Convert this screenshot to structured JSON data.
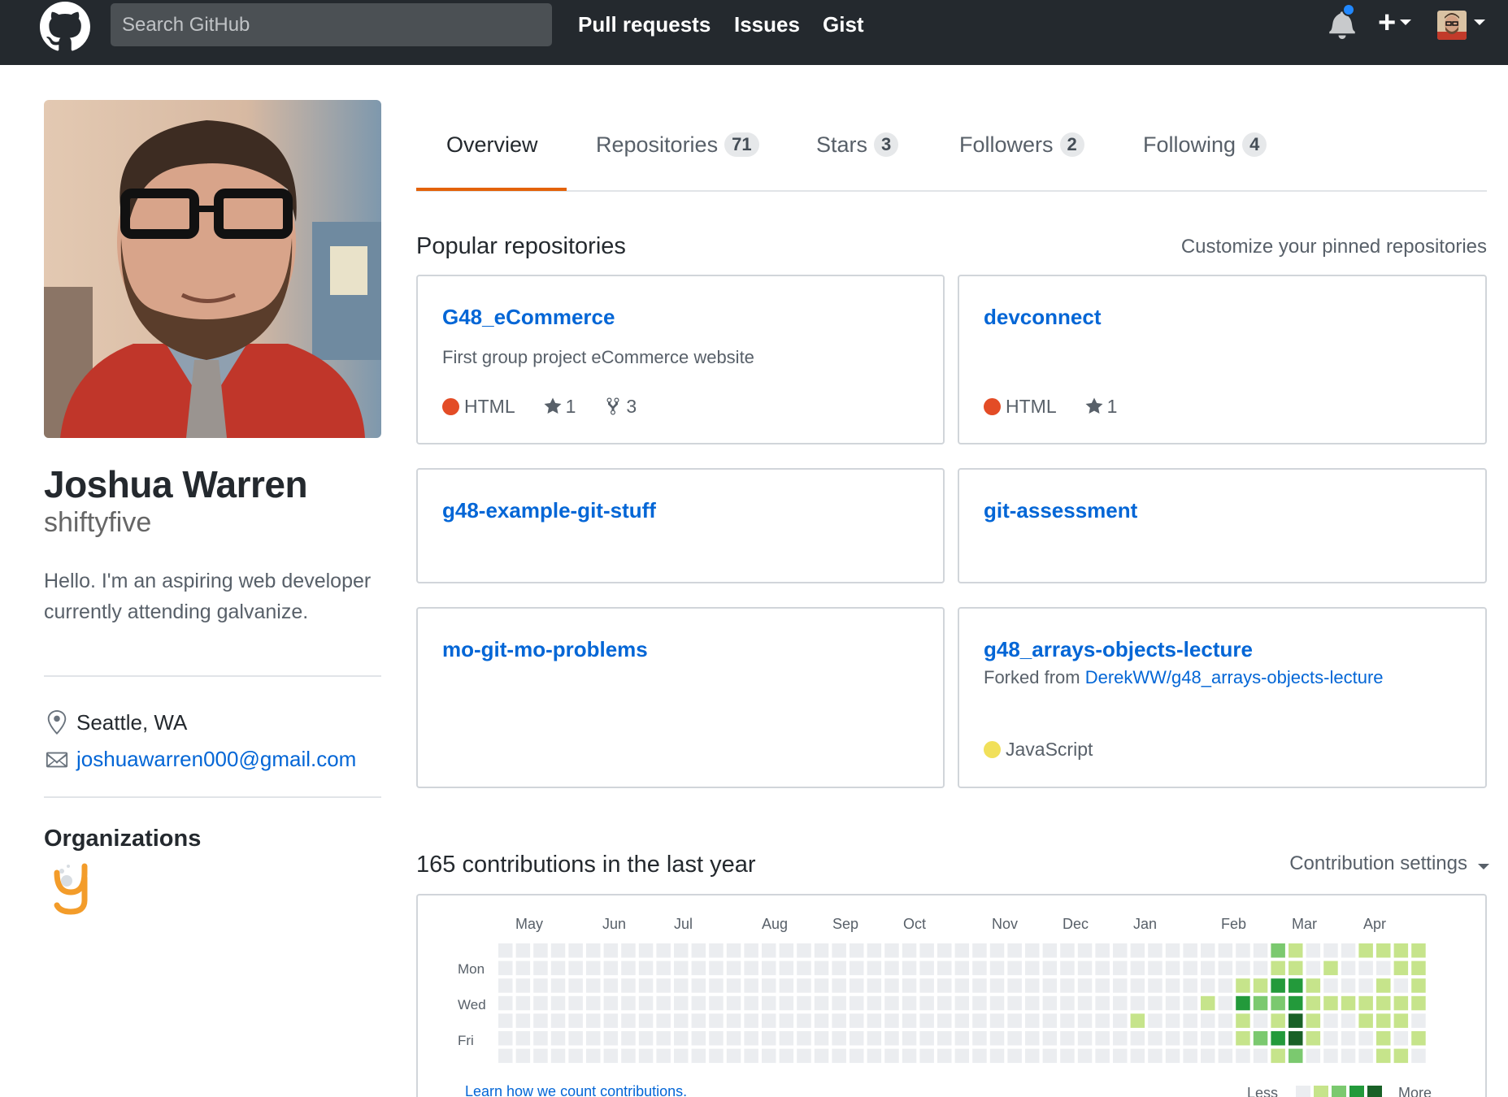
{
  "header": {
    "search_placeholder": "Search GitHub",
    "nav": [
      "Pull requests",
      "Issues",
      "Gist"
    ],
    "plus_label": "+",
    "icons": [
      "github-logo-icon",
      "bell-icon",
      "plus-icon",
      "caret-down-icon"
    ],
    "notification_dot_color": "#2188ff"
  },
  "profile": {
    "fullname": "Joshua Warren",
    "username": "shiftyfive",
    "bio": "Hello. I'm an aspiring web developer currently attending galvanize.",
    "location": "Seattle, WA",
    "email": "joshuawarren000@gmail.com",
    "organizations_title": "Organizations"
  },
  "tabs": [
    {
      "label": "Overview",
      "count": null,
      "active": true
    },
    {
      "label": "Repositories",
      "count": "71",
      "active": false
    },
    {
      "label": "Stars",
      "count": "3",
      "active": false
    },
    {
      "label": "Followers",
      "count": "2",
      "active": false
    },
    {
      "label": "Following",
      "count": "4",
      "active": false
    }
  ],
  "pinned": {
    "title": "Popular repositories",
    "customize_link": "Customize your pinned repositories",
    "repos": [
      {
        "name": "G48_eCommerce",
        "description": "First group project eCommerce website",
        "language": "HTML",
        "language_color": "#e34c26",
        "stars": "1",
        "forks": "3"
      },
      {
        "name": "devconnect",
        "language": "HTML",
        "language_color": "#e34c26",
        "stars": "1"
      },
      {
        "name": "g48-example-git-stuff"
      },
      {
        "name": "git-assessment"
      },
      {
        "name": "mo-git-mo-problems"
      },
      {
        "name": "g48_arrays-objects-lecture",
        "forked_from_prefix": "Forked from",
        "forked_from": "DerekWW/g48_arrays-objects-lecture",
        "language": "JavaScript",
        "language_color": "#f1e05a"
      }
    ]
  },
  "contributions": {
    "title": "165 contributions in the last year",
    "settings_label": "Contribution settings",
    "months": [
      "May",
      "Jun",
      "Jul",
      "Aug",
      "Sep",
      "Oct",
      "Nov",
      "Dec",
      "Jan",
      "Feb",
      "Mar",
      "Apr"
    ],
    "weekdays": [
      "Mon",
      "Wed",
      "Fri"
    ],
    "learn_link": "Learn how we count contributions.",
    "legend_less": "Less",
    "legend_more": "More",
    "colors": [
      "#ebedf0",
      "#c6e48b",
      "#7bc96f",
      "#239a3b",
      "#196127"
    ],
    "weeks": 53,
    "active_days": [
      [
        36,
        4,
        1
      ],
      [
        40,
        3,
        1
      ],
      [
        42,
        2,
        1
      ],
      [
        42,
        3,
        3
      ],
      [
        42,
        4,
        1
      ],
      [
        42,
        5,
        1
      ],
      [
        43,
        2,
        1
      ],
      [
        43,
        3,
        2
      ],
      [
        43,
        5,
        2
      ],
      [
        44,
        0,
        2
      ],
      [
        44,
        1,
        1
      ],
      [
        44,
        2,
        3
      ],
      [
        44,
        3,
        2
      ],
      [
        44,
        4,
        1
      ],
      [
        44,
        5,
        3
      ],
      [
        44,
        6,
        1
      ],
      [
        45,
        0,
        1
      ],
      [
        45,
        1,
        1
      ],
      [
        45,
        2,
        3
      ],
      [
        45,
        3,
        3
      ],
      [
        45,
        4,
        4
      ],
      [
        45,
        5,
        4
      ],
      [
        45,
        6,
        2
      ],
      [
        46,
        2,
        1
      ],
      [
        46,
        3,
        1
      ],
      [
        46,
        4,
        1
      ],
      [
        46,
        5,
        1
      ],
      [
        47,
        1,
        1
      ],
      [
        47,
        3,
        1
      ],
      [
        48,
        3,
        1
      ],
      [
        49,
        0,
        1
      ],
      [
        49,
        3,
        1
      ],
      [
        49,
        4,
        1
      ],
      [
        50,
        0,
        1
      ],
      [
        50,
        2,
        1
      ],
      [
        50,
        3,
        1
      ],
      [
        50,
        4,
        1
      ],
      [
        50,
        5,
        1
      ],
      [
        50,
        6,
        1
      ],
      [
        51,
        0,
        1
      ],
      [
        51,
        1,
        1
      ],
      [
        51,
        3,
        1
      ],
      [
        51,
        4,
        1
      ],
      [
        51,
        6,
        1
      ],
      [
        52,
        0,
        1
      ],
      [
        52,
        1,
        1
      ],
      [
        52,
        2,
        1
      ],
      [
        52,
        3,
        1
      ],
      [
        52,
        5,
        1
      ]
    ]
  }
}
